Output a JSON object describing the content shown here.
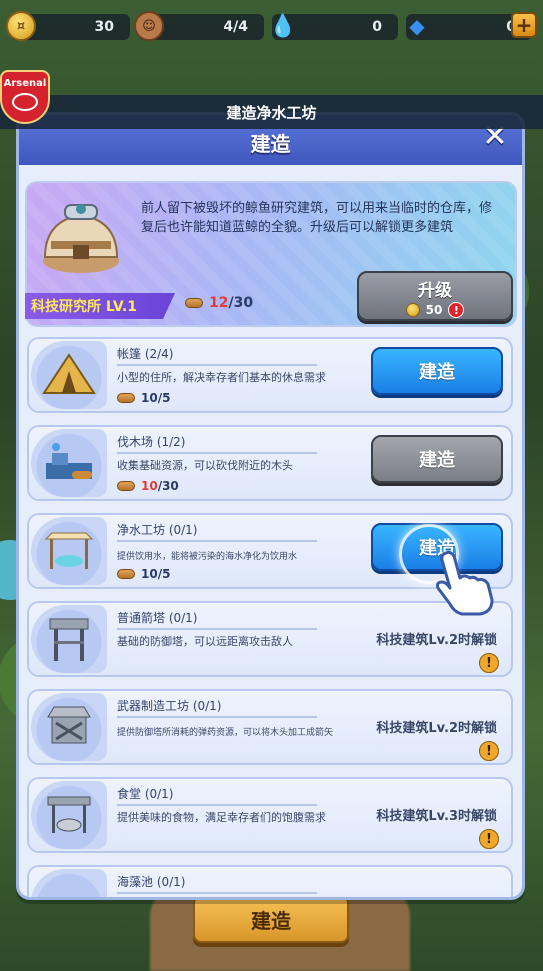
{
  "resources": {
    "gold": "30",
    "population": "4/4",
    "water": "0",
    "gems": "0",
    "plus": "+"
  },
  "badge": {
    "text": "Arsenal"
  },
  "window_title": "建造净水工坊",
  "panel": {
    "title": "建造",
    "close": "✕"
  },
  "hero": {
    "description": "前人留下被毁坏的鲸鱼研究建筑，可以用来当临时的仓库，修复后也许能知道蓝鲸的全貌。升级后可以解锁更多建筑",
    "level_label": "科技研究所 LV.1",
    "wood_current": "12",
    "wood_total": "/30",
    "upgrade_label": "升级",
    "upgrade_cost": "50",
    "alert": "!"
  },
  "buildings": [
    {
      "name": "帐篷 (2/4)",
      "desc": "小型的住所，解决幸存者们基本的休息需求",
      "wood_cur": "10",
      "wood_total": "/5",
      "action": "建造",
      "state": "blue"
    },
    {
      "name": "伐木场 (1/2)",
      "desc": "收集基础资源，可以砍伐附近的木头",
      "wood_cur": "10",
      "wood_total": "/30",
      "action": "建造",
      "state": "gray"
    },
    {
      "name": "净水工坊 (0/1)",
      "desc": "提供饮用水，能将被污染的海水净化为饮用水",
      "wood_cur": "10",
      "wood_total": "/5",
      "action": "建造",
      "state": "blue"
    },
    {
      "name": "普通箭塔 (0/1)",
      "desc": "基础的防御塔，可以远距离攻击敌人",
      "locked": "科技建筑Lv.2时解锁"
    },
    {
      "name": "武器制造工坊 (0/1)",
      "desc": "提供防御塔所消耗的弹药资源，可以将木头加工成箭矢",
      "locked": "科技建筑Lv.2时解锁"
    },
    {
      "name": "食堂 (0/1)",
      "desc": "提供美味的食物，满足幸存者们的饱腹需求",
      "locked": "科技建筑Lv.3时解锁"
    },
    {
      "name": "海藻池 (0/1)"
    }
  ],
  "bottom_button": "建造",
  "colors": {
    "accent_blue": "#1a7fe6",
    "panel_header": "#3d57bf",
    "warning_red": "#e03a3a",
    "gold_button": "#d8962a"
  }
}
